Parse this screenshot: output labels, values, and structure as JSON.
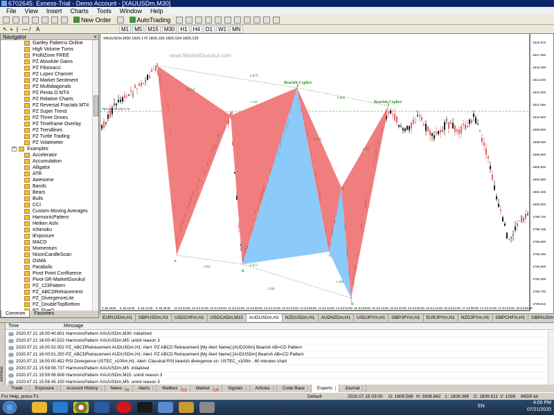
{
  "window": {
    "title": "6702645: Exness-Trial - Demo Account - [XAUUSDm,M30]"
  },
  "menu": [
    "File",
    "View",
    "Insert",
    "Charts",
    "Tools",
    "Window",
    "Help"
  ],
  "toolbar": {
    "new_order": "New Order",
    "autotrading": "AutoTrading"
  },
  "timeframes": [
    "M1",
    "M5",
    "M15",
    "M30",
    "H1",
    "H4",
    "D1",
    "W1",
    "MN"
  ],
  "navigator": {
    "title": "Navigator",
    "items": [
      {
        "label": "Gartley Patterns Online",
        "level": 2
      },
      {
        "label": "High Volume Turns",
        "level": 2
      },
      {
        "label": "ProfitZone FREE",
        "level": 2
      },
      {
        "label": "PZ Absolute Gains",
        "level": 2
      },
      {
        "label": "PZ Fibonacci",
        "level": 2
      },
      {
        "label": "PZ Lopez Channel",
        "level": 2
      },
      {
        "label": "PZ Market Sentiment",
        "level": 2
      },
      {
        "label": "PZ Multidiagonals",
        "level": 2
      },
      {
        "label": "PZ Penta O MT4",
        "level": 2
      },
      {
        "label": "PZ Relative Charts",
        "level": 2
      },
      {
        "label": "PZ Reversal Fractals MT4",
        "level": 2
      },
      {
        "label": "PZ Super Trend",
        "level": 2
      },
      {
        "label": "PZ Three Drives",
        "level": 2
      },
      {
        "label": "PZ Timeframe Overlay",
        "level": 2
      },
      {
        "label": "PZ Trendlines",
        "level": 2
      },
      {
        "label": "PZ Turtle Trading",
        "level": 2
      },
      {
        "label": "PZ Volatmeter",
        "level": 2
      },
      {
        "label": "Examples",
        "level": 1
      },
      {
        "label": "Accelerator",
        "level": 2
      },
      {
        "label": "Accumulation",
        "level": 2
      },
      {
        "label": "Alligator",
        "level": 2
      },
      {
        "label": "ATR",
        "level": 2
      },
      {
        "label": "Awesome",
        "level": 2
      },
      {
        "label": "Bands",
        "level": 2
      },
      {
        "label": "Bears",
        "level": 2
      },
      {
        "label": "Bulls",
        "level": 2
      },
      {
        "label": "CCI",
        "level": 2
      },
      {
        "label": "Custom Moving Averages",
        "level": 2
      },
      {
        "label": "HarmonicPattern",
        "level": 2
      },
      {
        "label": "Heiken Ashi",
        "level": 2
      },
      {
        "label": "Ichimoku",
        "level": 2
      },
      {
        "label": "iExposure",
        "level": 2
      },
      {
        "label": "MACD",
        "level": 2
      },
      {
        "label": "Momentum",
        "level": 2
      },
      {
        "label": "NisonCandleScan",
        "level": 2
      },
      {
        "label": "OsMA",
        "level": 2
      },
      {
        "label": "Parabolic",
        "level": 2
      },
      {
        "label": "Pivot Point Confluence",
        "level": 2
      },
      {
        "label": "Pivot-SR-MarketGurukul",
        "level": 2
      },
      {
        "label": "PZ_123Pattern",
        "level": 2
      },
      {
        "label": "PZ_ABCDRetracement",
        "level": 2
      },
      {
        "label": "PZ_DivergenceLite",
        "level": 2
      },
      {
        "label": "PZ_DoubleTopBottom",
        "level": 2
      },
      {
        "label": "PZ_FiveO",
        "level": 2
      }
    ],
    "tabs": [
      "Common",
      "Favorites"
    ]
  },
  "chart": {
    "header": "XAUUSDm,M30 1826.170 1826.156 1826.534 1826.125",
    "watermark": "www.MarketGurukul.com",
    "sell_label": "#84419 1m sell 0.75",
    "price_labels": [
      "1819.375",
      "1817.830",
      "1816.290",
      "1814.830",
      "1813.200",
      "1811.655",
      "1810.920",
      "1809.660",
      "1808.020",
      "1806.650",
      "1805.930",
      "1804.690",
      "1802.465",
      "1800.920",
      "1799.720",
      "1798.435",
      "1796.890",
      "1795.345",
      "1793.800",
      "1792.255",
      "1790.730",
      "1789.815"
    ],
    "time_labels": [
      "9 Jul 2020",
      "9 Jul 15:00",
      "9 Jul 19:00",
      "9 Jul 23:00",
      "10 Jul 03:00",
      "10 Jul 07:00",
      "10 Jul 11:00",
      "10 Jul 15:00",
      "10 Jul 19:00",
      "13 Jul 03:00",
      "13 Jul 07:00",
      "13 Jul 11:00",
      "13 Jul 15:00",
      "13 Jul 19:00",
      "13 Jul 23:00",
      "14 Jul 03:00",
      "14 Jul 07:00",
      "14 Jul 11:00",
      "14 Jul 15:00",
      "14 Jul 19:00",
      "15 Jul 03:00",
      "15 Jul 07:00",
      "15 Jul 11:00",
      "15 Jul 15:00"
    ],
    "time_labels_visible": [
      "9 Jul 2020",
      "9 Jul 16:00",
      "9 Jul 12:00",
      "9 Jul 20:00",
      "10 Jul 04:00",
      "10 Jul 12:00",
      "10 Jul 20:00",
      "12 Jul 22:00",
      "13 Jul 06:00",
      "13 Jul 14:00",
      "13 Jul 22:00",
      "14 Jul 06:00",
      "14 Jul 14:00",
      "14 Jul 22:00",
      "15 Jul 06:00",
      "15 Jul 14:00",
      "15 Jul 22:00",
      "16 Jul 06:00",
      "16 Jul 14:00",
      "16 Jul 22:00",
      "17 Jul 06:00",
      "17 Jul 14:00",
      "17 Jul 22:00",
      "18 Jul 06:00"
    ],
    "pattern_labels": {
      "bearish1": "Bearish Cypher",
      "bearish2": "Bearish Cypher"
    },
    "point_labels": [
      "X",
      "A",
      "B",
      "C",
      "D",
      "K",
      "X",
      "C",
      "D"
    ],
    "ratios": [
      "0.879",
      "0.724",
      "1.181",
      "0.890",
      "1.062",
      "0.957",
      "1.188",
      "0.873",
      "1.107",
      "1.288"
    ]
  },
  "chart_tabs": [
    "EURUSDm,H1",
    "GBPUSDm,H1",
    "USDCHFm,H1",
    "USDCADm,M15",
    "AUDUSDm,H1",
    "NZDUSDm,H1",
    "AUDNZDm,H1",
    "USDJPYm,H1",
    "GBPJPYm,H1",
    "EURJPYm,H1",
    "NZDJPYm,H1",
    "GBPCHFm,H1",
    "GBPAUDm,H1",
    "AL"
  ],
  "terminal": {
    "side_label": "Terminal",
    "columns": [
      "Time",
      "Message"
    ],
    "rows": [
      {
        "time": "2020.07.21 16:00:40.601",
        "message": "HarmonicPattern XAUUSDm,M30: initialized"
      },
      {
        "time": "2020.07.21 16:00:40.522",
        "message": "HarmonicPattern XAUUSDm,M5: uninit reason 3"
      },
      {
        "time": "2020.07.21 16:00:02.052",
        "message": "PZ_ABCDRetracement AUDUSDm,H1: Alert: PZ ABCD Retracement [My Alert Name] [AUD200m] Bearish AB=CD Pattern"
      },
      {
        "time": "2020.07.21 16:00:01.250",
        "message": "PZ_ABCDRetracement AUDUSDm,H1: Alert: PZ ABCD Retracement [My Alert Name] [AUDUSDm] Bearish AB=CD Pattern"
      },
      {
        "time": "2020.07.21 16:00:00.452",
        "message": "RSI Divergence USTEC_x100m,H1: Alert: Classical RSI bearish divergence on: USTEC_x100m , 60 minutes chart"
      },
      {
        "time": "2020.07.21 15:59:08.737",
        "message": "HarmonicPattern XAUUSDm,M5: initialized"
      },
      {
        "time": "2020.07.21 15:59:08.608",
        "message": "HarmonicPattern XAUUSDm,M15: uninit reason 3"
      },
      {
        "time": "2020.07.21 15:58:45.150",
        "message": "HarmonicPattern XAUUSDm,M5: uninit reason 3"
      }
    ]
  },
  "bottom_tabs": [
    {
      "label": "Trade",
      "count": ""
    },
    {
      "label": "Exposure",
      "count": ""
    },
    {
      "label": "Account History",
      "count": ""
    },
    {
      "label": "News",
      "count": "99"
    },
    {
      "label": "Alerts",
      "count": ""
    },
    {
      "label": "Mailbox",
      "count": "218"
    },
    {
      "label": "Market",
      "count": "139"
    },
    {
      "label": "Signals",
      "count": ""
    },
    {
      "label": "Articles",
      "count": ""
    },
    {
      "label": "Code Base",
      "count": ""
    },
    {
      "label": "Experts",
      "count": ""
    },
    {
      "label": "Journal",
      "count": ""
    }
  ],
  "status": {
    "help": "For Help, press F1",
    "profile": "Default",
    "datetime": "2020.07.15 03:00",
    "open": "O: 1808.566",
    "high": "H: 1808.842",
    "low": "L: 1808.386",
    "close": "C: 1808.611",
    "volume": "V: 1039",
    "traffic": "865/5 kb"
  },
  "taskbar": {
    "lang": "EN",
    "time": "4:00 PM",
    "date": "07/21/2020"
  },
  "colors": {
    "bearish_fill": "#f07070",
    "bullish_fill": "#80c4f8",
    "candle_up": "#000000",
    "candle_down": "#e05050",
    "label_green": "#2a8a2a",
    "grid": "#c0c0c0"
  }
}
